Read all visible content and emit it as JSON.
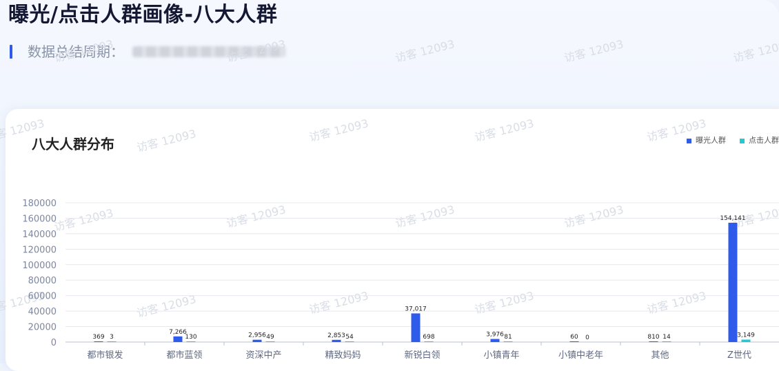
{
  "header": {
    "title": "曝光/点击人群画像-八大人群",
    "period_label": "数据总结周期："
  },
  "watermark": "访客 12093",
  "colors": {
    "exposure": "#2f5bea",
    "click": "#1ecbd6",
    "accent": "#2f5bea"
  },
  "chart_data": {
    "type": "bar",
    "title": "八大人群分布",
    "categories": [
      "都市银发",
      "都市蓝领",
      "资深中产",
      "精致妈妈",
      "新锐白领",
      "小镇青年",
      "小镇中老年",
      "其他",
      "Z世代"
    ],
    "series": [
      {
        "name": "曝光人群",
        "values": [
          369,
          7266,
          2956,
          2853,
          37017,
          3976,
          60,
          810,
          154141
        ],
        "labels": [
          "369",
          "7,266",
          "2,956",
          "2,853",
          "37,017",
          "3,976",
          "60",
          "810",
          "154,141"
        ]
      },
      {
        "name": "点击人群",
        "values": [
          3,
          130,
          49,
          54,
          698,
          81,
          0,
          14,
          3149
        ],
        "labels": [
          "3",
          "130",
          "49",
          "54",
          "698",
          "81",
          "0",
          "14",
          "3,149"
        ]
      }
    ],
    "yticks": [
      "0",
      "20000",
      "40000",
      "60000",
      "80000",
      "100000",
      "120000",
      "140000",
      "160000",
      "180000"
    ],
    "ylim": [
      0,
      180000
    ],
    "grid": true,
    "legend_position": "top-right"
  }
}
